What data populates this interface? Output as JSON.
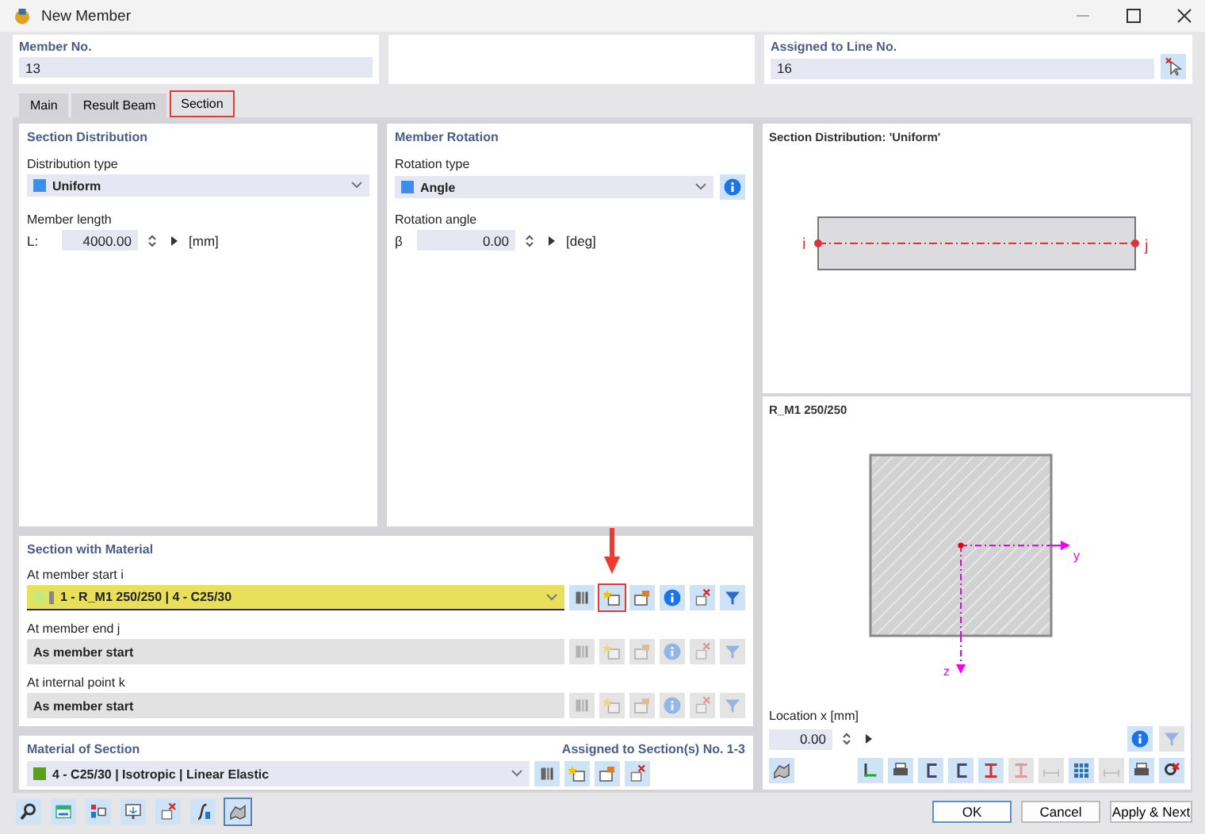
{
  "window": {
    "title": "New Member"
  },
  "member_no": {
    "label": "Member No.",
    "value": "13"
  },
  "assigned_line": {
    "label": "Assigned to Line No.",
    "value": "16"
  },
  "tabs": [
    {
      "label": "Main",
      "selected": false,
      "highlighted": false
    },
    {
      "label": "Result Beam",
      "selected": false,
      "highlighted": false
    },
    {
      "label": "Section",
      "selected": true,
      "highlighted": true
    }
  ],
  "section_distribution": {
    "title": "Section Distribution",
    "type_label": "Distribution type",
    "type_value": "Uniform",
    "length_label": "Member length",
    "length_symbol": "L:",
    "length_value": "4000.00",
    "length_unit": "[mm]"
  },
  "member_rotation": {
    "title": "Member Rotation",
    "type_label": "Rotation type",
    "type_value": "Angle",
    "angle_label": "Rotation angle",
    "angle_symbol": "β",
    "angle_value": "0.00",
    "angle_unit": "[deg]"
  },
  "section_with_material": {
    "title": "Section with Material",
    "rows": [
      {
        "label": "At member start i",
        "value": "1 - R_M1 250/250 | 4 - C25/30",
        "highlighted": true,
        "disabled": false,
        "buttons": [
          {
            "highlighted": false
          },
          {
            "highlighted": true
          },
          {
            "highlighted": false
          },
          {
            "highlighted": false
          },
          {
            "highlighted": false
          },
          {
            "highlighted": false
          }
        ]
      },
      {
        "label": "At member end j",
        "value": "As member start",
        "highlighted": false,
        "disabled": true,
        "buttons": [
          {
            "highlighted": false
          },
          {
            "highlighted": false
          },
          {
            "highlighted": false
          },
          {
            "highlighted": false
          },
          {
            "highlighted": false
          },
          {
            "highlighted": false
          }
        ]
      },
      {
        "label": "At internal point k",
        "value": "As member start",
        "highlighted": false,
        "disabled": true,
        "buttons": [
          {
            "highlighted": false
          },
          {
            "highlighted": false
          },
          {
            "highlighted": false
          },
          {
            "highlighted": false
          },
          {
            "highlighted": false
          },
          {
            "highlighted": false
          }
        ]
      }
    ]
  },
  "material_of_section": {
    "title": "Material of Section",
    "assigned": "Assigned to Section(s) No. 1-3",
    "value": "4 - C25/30 | Isotropic | Linear Elastic"
  },
  "preview": {
    "title": "Section Distribution: 'Uniform'",
    "end_i": "i",
    "end_j": "j",
    "section_name": "R_M1 250/250",
    "axis_y": "y",
    "axis_z": "z",
    "location_label": "Location x [mm]",
    "location_value": "0.00"
  },
  "preview_toolbar": [
    {
      "disabled": false
    },
    {
      "disabled": false
    },
    {
      "disabled": false
    },
    {
      "disabled": false
    },
    {
      "disabled": false
    },
    {
      "disabled": true
    },
    {
      "disabled": true
    },
    {
      "disabled": false
    },
    {
      "disabled": true
    },
    {
      "disabled": false
    },
    {
      "disabled": false
    }
  ],
  "bottom_tools": [
    {
      "selected": false
    },
    {
      "selected": false
    },
    {
      "selected": false
    },
    {
      "selected": false
    },
    {
      "selected": false
    },
    {
      "selected": false
    },
    {
      "selected": true
    }
  ],
  "buttons": [
    {
      "label": "OK",
      "default": true
    },
    {
      "label": "Cancel",
      "default": false
    },
    {
      "label": "Apply & Next",
      "default": false
    }
  ]
}
